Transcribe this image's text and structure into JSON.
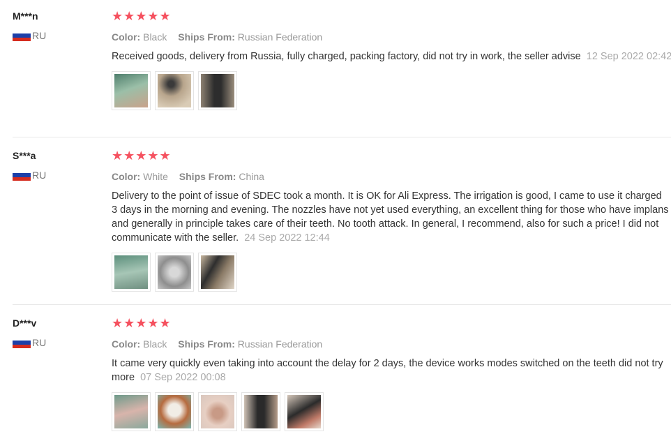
{
  "colors": {
    "star": "#f5515f",
    "flag_white": "#ffffff",
    "flag_blue": "#1c3fa8",
    "flag_red": "#d52b1e"
  },
  "reviews": [
    {
      "user": "M***n",
      "country": "RU",
      "stars": "★★★★★",
      "color_label": "Color:",
      "color_value": "Black",
      "ships_label": "Ships From:",
      "ships_value": "Russian Federation",
      "text": "Received goods, delivery from Russia, fully charged, packing factory, did not try in work, the seller advise",
      "date": "12 Sep 2022 02:42",
      "photos": [
        "photo-1",
        "photo-2",
        "photo-3"
      ]
    },
    {
      "user": "S***a",
      "country": "RU",
      "stars": "★★★★★",
      "color_label": "Color:",
      "color_value": "White",
      "ships_label": "Ships From:",
      "ships_value": "China",
      "text": "Delivery to the point of issue of SDEC took a month. It is OK for Ali Express. The irrigation is good, I came to use it charged 3 days in the morning and evening. The nozzles have not yet used everything, an excellent thing for those who have implans and generally in principle takes care of their teeth. No tooth attack. In general, I recommend, also for such a price! I did not communicate with the seller.",
      "date": "24 Sep 2022 12:44",
      "photos": [
        "photo-1",
        "photo-2",
        "photo-3"
      ]
    },
    {
      "user": "D***v",
      "country": "RU",
      "stars": "★★★★★",
      "color_label": "Color:",
      "color_value": "Black",
      "ships_label": "Ships From:",
      "ships_value": "Russian Federation",
      "text": "It came very quickly even taking into account the delay for 2 days, the device works modes switched on the teeth did not try more",
      "date": "07 Sep 2022 00:08",
      "photos": [
        "photo-1",
        "photo-2",
        "photo-3",
        "photo-4",
        "photo-5"
      ]
    }
  ]
}
